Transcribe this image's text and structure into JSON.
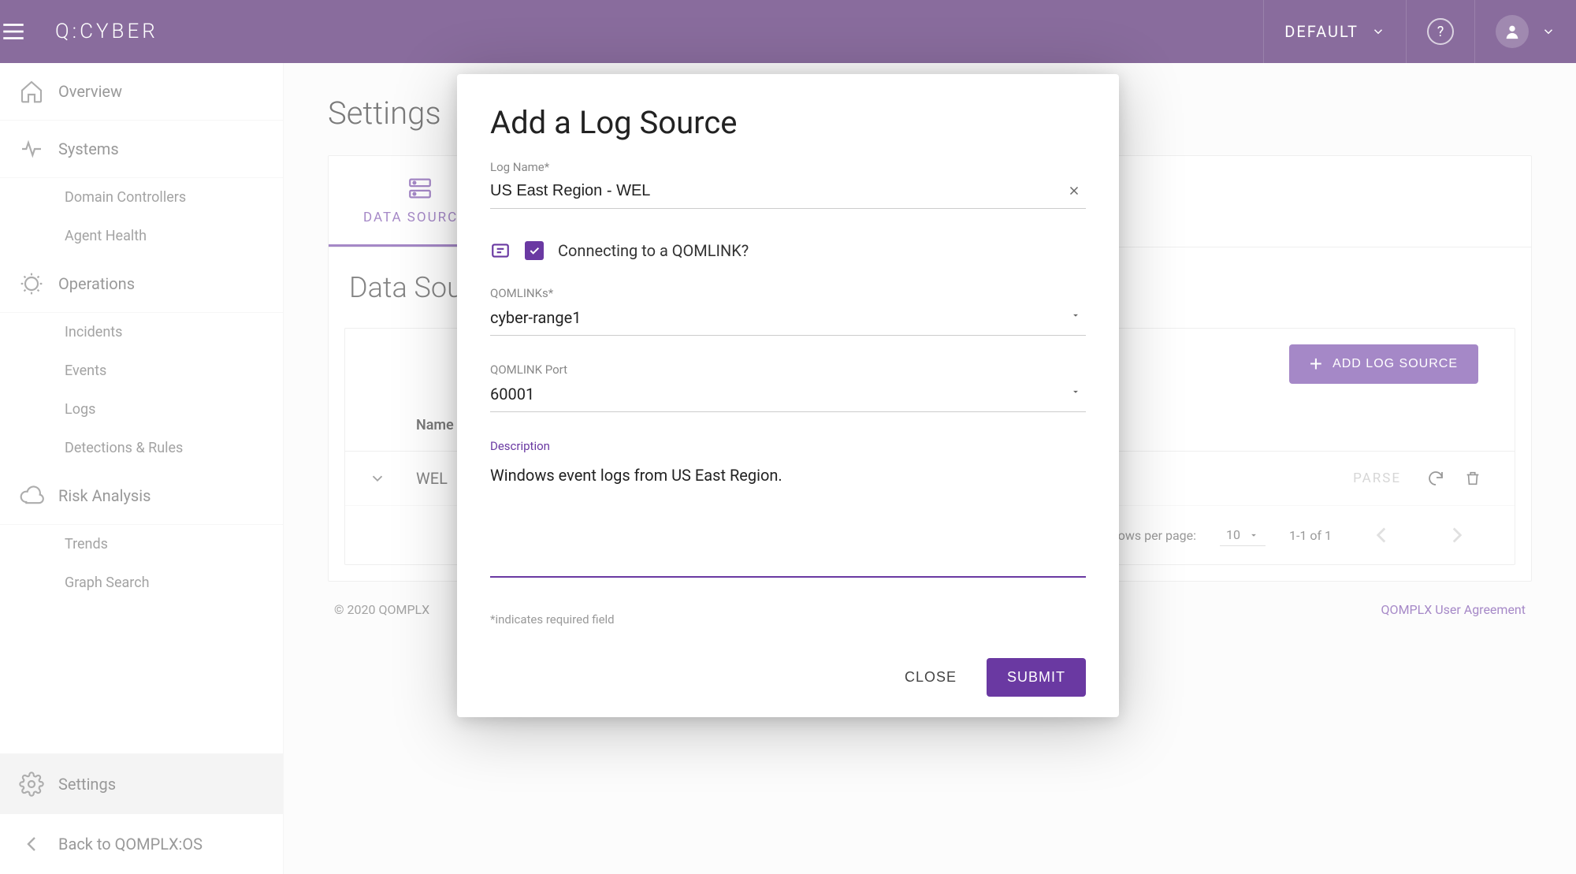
{
  "brand": {
    "logo_text": "Q:CYBER"
  },
  "topbar": {
    "tenant_label": "DEFAULT"
  },
  "sidebar": {
    "groups": [
      {
        "label": "Overview",
        "items": []
      },
      {
        "label": "Systems",
        "items": [
          "Domain Controllers",
          "Agent Health"
        ]
      },
      {
        "label": "Operations",
        "items": [
          "Incidents",
          "Events",
          "Logs",
          "Detections & Rules"
        ]
      },
      {
        "label": "Risk Analysis",
        "items": [
          "Trends",
          "Graph Search"
        ]
      }
    ],
    "bottom": {
      "settings_label": "Settings",
      "back_label": "Back to QOMPLX:OS"
    }
  },
  "page": {
    "title": "Settings",
    "tabs": {
      "active": "DATA SOURCES"
    },
    "section_title": "Data Sources",
    "add_button_label": "ADD LOG SOURCE",
    "table": {
      "headers": {
        "name": "Name"
      },
      "rows": [
        {
          "name": "WEL",
          "action_parse": "PARSE"
        }
      ],
      "pagination": {
        "rows_per_page_label": "Rows per page:",
        "page_size": "10",
        "range_text": "1-1 of 1"
      }
    },
    "footer": {
      "copyright": "© 2020 QOMPLX",
      "agreement_link": "QOMPLX User Agreement"
    }
  },
  "modal": {
    "title": "Add a Log Source",
    "log_name": {
      "label": "Log Name*",
      "value": "US East Region - WEL"
    },
    "qomlink_checkbox_label": "Connecting to a QOMLINK?",
    "qomlinks": {
      "label": "QOMLINKs*",
      "value": "cyber-range1"
    },
    "port": {
      "label": "QOMLINK Port",
      "value": "60001"
    },
    "description": {
      "label": "Description",
      "value": "Windows event logs from US East Region."
    },
    "required_hint": "*indicates required field",
    "close_label": "CLOSE",
    "submit_label": "SUBMIT"
  }
}
